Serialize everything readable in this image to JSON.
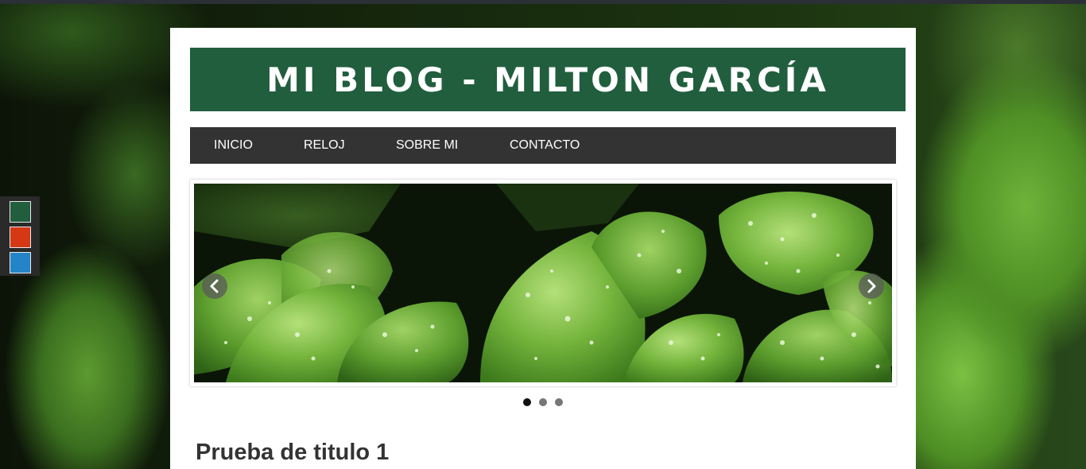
{
  "site": {
    "title": "MI BLOG - MILTON GARCÍA",
    "header_color": "#215e3e"
  },
  "nav": {
    "items": [
      {
        "label": "INICIO"
      },
      {
        "label": "RELOJ"
      },
      {
        "label": "SOBRE MI"
      },
      {
        "label": "CONTACTO"
      }
    ],
    "background": "#333333"
  },
  "theme_switcher": {
    "swatches": [
      {
        "name": "green",
        "color": "#215e3e"
      },
      {
        "name": "red",
        "color": "#d63815"
      },
      {
        "name": "blue",
        "color": "#2385c7"
      }
    ]
  },
  "carousel": {
    "slide_count": 3,
    "active_index": 0,
    "prev_icon": "chevron-left-icon",
    "next_icon": "chevron-right-icon"
  },
  "post": {
    "title": "Prueba de titulo 1"
  }
}
